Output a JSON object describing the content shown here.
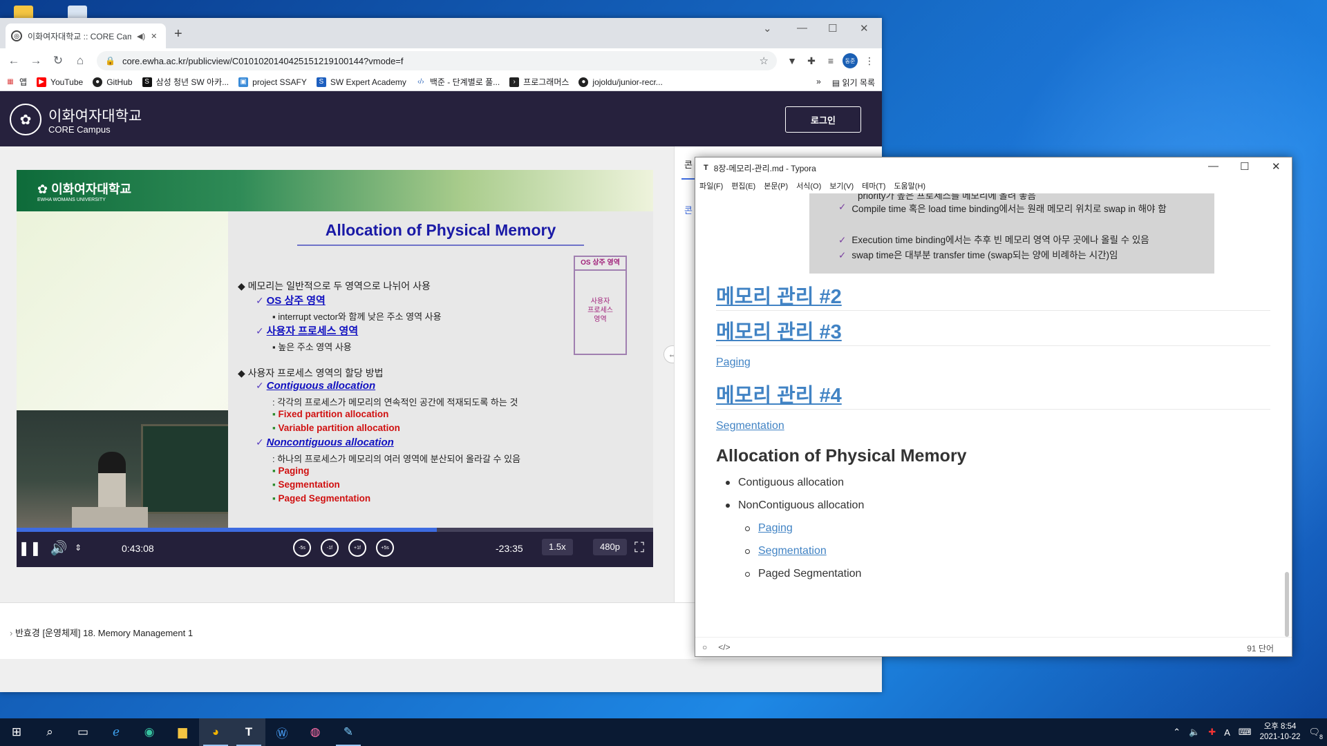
{
  "browser": {
    "tab_title": "이화여자대학교 :: CORE Campus",
    "url": "core.ewha.ac.kr/publicview/C0101020140425151219100144?vmode=f",
    "avatar_text": "동준",
    "bookmarks": [
      "앱",
      "YouTube",
      "GitHub",
      "삼성 청년 SW 아카...",
      "project SSAFY",
      "SW Expert Academy",
      "백준 - 단계별로 풀...",
      "프로그래머스",
      "jojoldu/junior-recr..."
    ],
    "reading_list": "읽기 목록",
    "more": "»"
  },
  "site": {
    "name": "이화여자대학교",
    "sub": "CORE Campus",
    "login": "로그인",
    "side_tab": "콘",
    "side_tab2": "콘",
    "lecture_title": "반효경 [운영체제] 18. Memory Management 1"
  },
  "slide": {
    "logo": "이화여자대학교",
    "logo_sub": "EWHA WOMANS UNIVERSITY",
    "title": "Allocation of Physical Memory",
    "l1": "메모리는 일반적으로 두 영역으로 나뉘어 사용",
    "l2": "OS 상주 영역",
    "l3": "interrupt vector와 함께 낮은 주소 영역 사용",
    "l4": "사용자 프로세스 영역",
    "l5": "높은 주소 영역 사용",
    "l6": "사용자 프로세스 영역의 할당 방법",
    "l7": "Contiguous allocation",
    "l8": ": 각각의 프로세스가 메모리의 연속적인 공간에 적재되도록 하는 것",
    "l9": "Fixed partition allocation",
    "l10": "Variable partition allocation",
    "l11": "Noncontiguous allocation",
    "l12": ": 하나의 프로세스가 메모리의 여러 영역에 분산되어 올라갈 수 있음",
    "l13": "Paging",
    "l14": "Segmentation",
    "l15": "Paged Segmentation",
    "box_top": "OS 상주 영역",
    "box_body": [
      "사용자",
      "프로세스",
      "영역"
    ]
  },
  "player": {
    "elapsed": "0:43:08",
    "remaining": "-23:35",
    "speed": "1.5x",
    "quality": "480p",
    "progress": 0.66,
    "rw5": "-5s",
    "rw1": "-1f",
    "ff1": "+1f",
    "ff5": "+5s"
  },
  "typora": {
    "title": "8장-메모리-관리.md - Typora",
    "menu": [
      "파일(F)",
      "편집(E)",
      "본문(P)",
      "서식(O)",
      "보기(V)",
      "테마(T)",
      "도움말(H)"
    ],
    "img_lines": [
      "priority가 높은 프로세스를 메모리에 올려 놓음",
      "Compile time 혹은 load time binding에서는 원래 메모리 위치로 swap in 해야 함",
      "Execution time binding에서는 추후 빈 메모리 영역 아무 곳에나 올릴 수 있음",
      "swap time은 대부분 transfer time (swap되는 양에 비례하는 시간)임"
    ],
    "h2_2": "메모리 관리 #2",
    "h2_3": "메모리 관리 #3",
    "paging_link": "Paging",
    "h2_4": "메모리 관리 #4",
    "seg_link": "Segmentation",
    "h3": "Allocation of Physical Memory",
    "li1": "Contiguous allocation",
    "li2": "NonContiguous allocation",
    "sub1": "Paging",
    "sub2": "Segmentation",
    "sub3": "Paged Segmentation",
    "words": "91 단어"
  },
  "taskbar": {
    "time": "오후 8:54",
    "date": "2021-10-22",
    "notif": "8",
    "ime": "A"
  }
}
